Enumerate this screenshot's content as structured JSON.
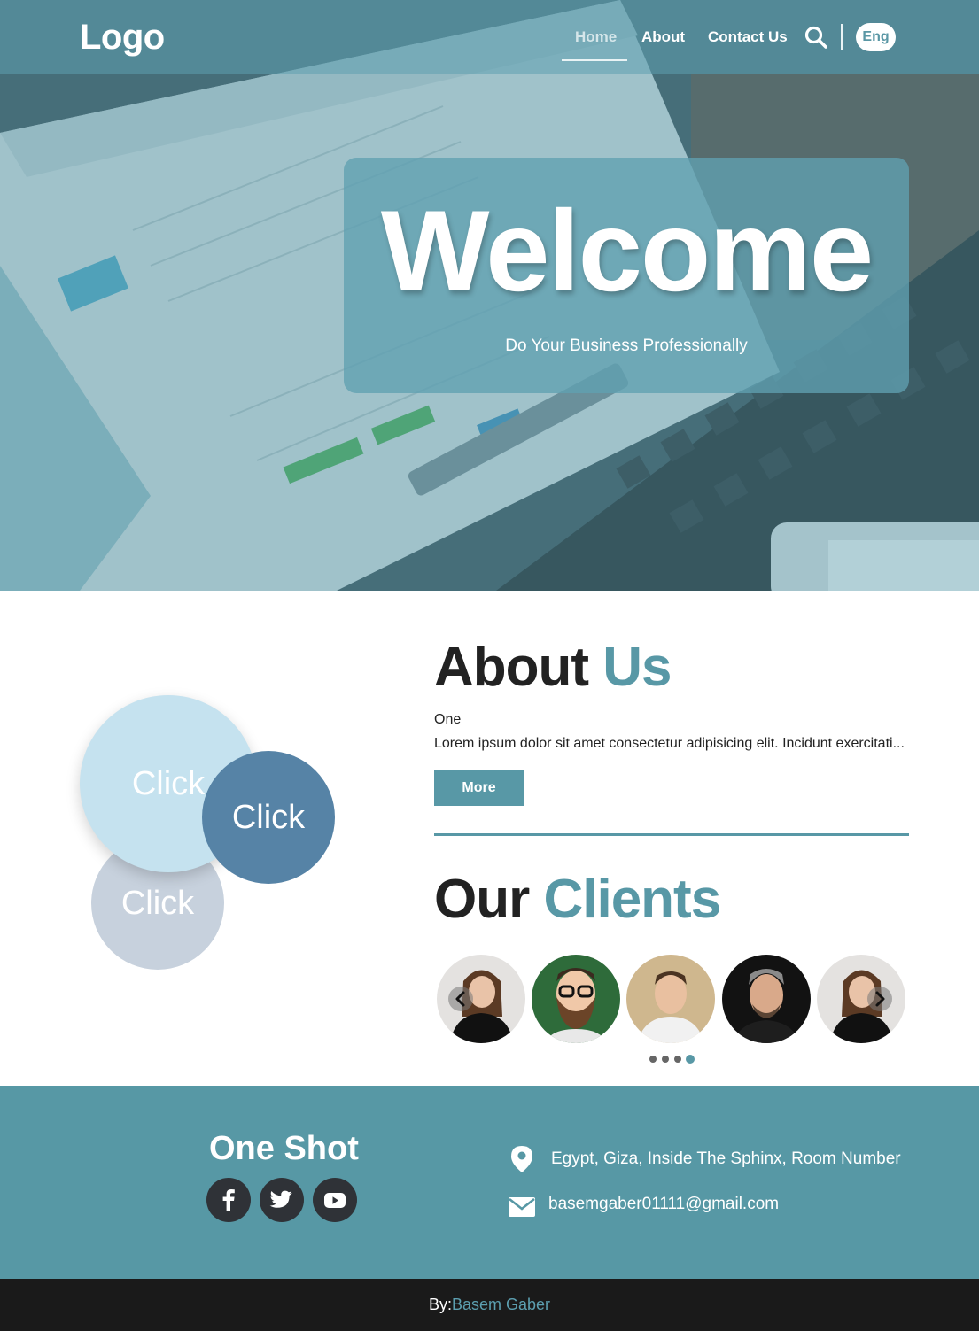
{
  "colors": {
    "accent": "#5898a6",
    "footer_bg": "#5798a5",
    "credits_bg": "#1a1a1a",
    "circle_light_blue": "#c5e2ef",
    "circle_dark_blue": "#5683a6",
    "circle_gray": "#c7d1dd"
  },
  "nav": {
    "logo": "Logo",
    "links": [
      "Home",
      "About",
      "Contact Us"
    ],
    "active_link": "Home",
    "search_icon": "search-icon",
    "language": "Eng"
  },
  "hero": {
    "title": "Welcome",
    "subtitle": "Do Your Business Professionally"
  },
  "about": {
    "circles": [
      "Click",
      "Click",
      "Click"
    ],
    "title_main": "About",
    "title_accent": "Us",
    "subheading": "One",
    "text": "Lorem ipsum dolor sit amet consectetur adipisicing elit. Incidunt exercitati...",
    "more_button": "More"
  },
  "clients": {
    "title_main": "Our",
    "title_accent": "Clients",
    "count": 5,
    "prev_icon": "chevron-left-icon",
    "next_icon": "chevron-right-icon",
    "dots": 4,
    "active_dot": 4
  },
  "footer": {
    "brand": "One Shot",
    "social": [
      "facebook-icon",
      "twitter-icon",
      "youtube-icon"
    ],
    "address": "Egypt, Giza, Inside The Sphinx, Room Number",
    "email": "basemgaber01111@gmail.com"
  },
  "credits": {
    "prefix": "By:",
    "author": "Basem Gaber"
  }
}
